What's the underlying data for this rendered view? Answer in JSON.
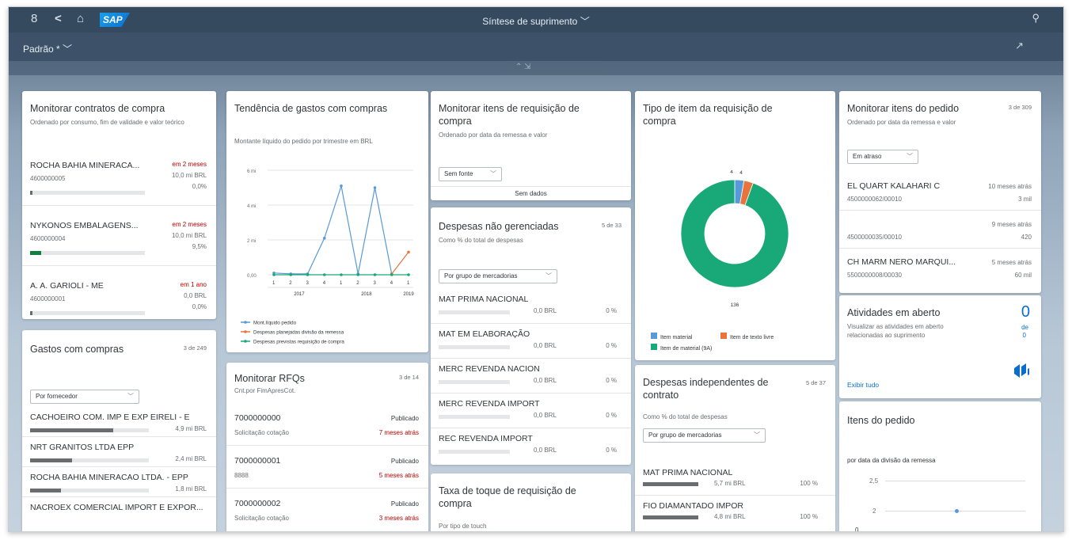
{
  "shell": {
    "title": "Síntese de suprimento",
    "title_chevron": "﹀",
    "user_icon": "8",
    "back_icon": "<",
    "home_icon": "⌂",
    "logo": "SAP",
    "search_icon": "⚲",
    "share_icon": "↗"
  },
  "variant": "Padrão * ﹀",
  "cards": {
    "contracts": {
      "title": "Monitorar contratos de compra",
      "subtitle": "Ordenado por consumo, fim de validade e valor teórico",
      "items": [
        {
          "name": "ROCHA BAHIA MINERACA...",
          "id": "4600000005",
          "time": "em 2 meses",
          "amount": "10,0 mi BRL",
          "percent": "0,0%",
          "fill": 0.02
        },
        {
          "name": "NYKONOS EMBALAGENS...",
          "id": "4600000004",
          "time": "em 2 meses",
          "amount": "10,0 mi BRL",
          "percent": "9,5%",
          "fill": 0.095
        },
        {
          "name": "A. A. GARIOLI - ME",
          "id": "4600000001",
          "time": "em 1 ano",
          "amount": "0,0 BRL",
          "percent": "0,0%",
          "fill": 0.02
        }
      ]
    },
    "gastos": {
      "title": "Gastos com compras",
      "count": "3 de 249",
      "select": "Por fornecedor",
      "items": [
        {
          "name": "CACHOEIRO COM. IMP E EXP EIRELI - E",
          "amount": "4,9 mi BRL",
          "fill": 0.7
        },
        {
          "name": "NRT GRANITOS LTDA EPP",
          "amount": "2,4 mi BRL",
          "fill": 0.35
        },
        {
          "name": "ROCHA BAHIA MINERACAO LTDA. - EPP",
          "amount": "1,8 mi BRL",
          "fill": 0.26
        },
        {
          "name": "NACROEX COMERCIAL IMPORT E EXPOR...",
          "amount": "",
          "fill": 0
        }
      ]
    },
    "trend": {
      "title": "Tendência de gastos com compras",
      "subtitle": "Montante líquido do pedido por trimestre em BRL"
    },
    "rfq": {
      "title": "Monitorar RFQs",
      "count": "3 de 14",
      "subtitle": "Cnt.por FimApresCot.",
      "items": [
        {
          "id": "7000000000",
          "status": "Publicado",
          "desc": "Solicitação cotação",
          "time": "7 meses atrás"
        },
        {
          "id": "7000000001",
          "status": "Publicado",
          "desc": "8888",
          "time": "5 meses atrás"
        },
        {
          "id": "7000000002",
          "status": "Publicado",
          "desc": "Solicitação cotação",
          "time": "3 meses atrás"
        }
      ]
    },
    "req": {
      "title": "Monitorar itens de requisição de compra",
      "subtitle": "Ordenado por data da remessa e valor",
      "select": "Sem fonte",
      "nodata": "Sem dados"
    },
    "despesas": {
      "title": "Despesas não gerenciadas",
      "count": "5 de 33",
      "subtitle": "Como % do total de despesas",
      "select": "Por grupo de mercadorias",
      "items": [
        {
          "name": "MAT PRIMA NACIONAL",
          "amount": "0,0 BRL",
          "pct": "0 %"
        },
        {
          "name": "MAT EM ELABORAÇÃO",
          "amount": "0,0 BRL",
          "pct": "0 %"
        },
        {
          "name": "MERC REVENDA NACION",
          "amount": "0,0 BRL",
          "pct": "0 %"
        },
        {
          "name": "MERC REVENDA IMPORT",
          "amount": "0,0 BRL",
          "pct": "0 %"
        },
        {
          "name": "REC REVENDA IMPORT",
          "amount": "0,0 BRL",
          "pct": "0 %"
        }
      ]
    },
    "taxa": {
      "title": "Taxa de toque de requisição de compra",
      "subtitle": "Por tipo de touch"
    },
    "tipo": {
      "title": "Tipo de item da requisição de compra",
      "label_a": "4",
      "label_b": "4",
      "label_main": "136",
      "legend": [
        {
          "label": "Item material",
          "color": "#5899da"
        },
        {
          "label": "Item de texto livre",
          "color": "#e8743b"
        },
        {
          "label": "Item de material (9A)",
          "color": "#19a979"
        }
      ]
    },
    "indep": {
      "title": "Despesas independentes de contrato",
      "count": "5 de 37",
      "subtitle": "Como % do total de despesas",
      "select": "Por grupo de mercadorias",
      "items": [
        {
          "name": "MAT PRIMA NACIONAL",
          "amount": "5,7 mi BRL",
          "pct": "100 %",
          "fill": 0.45
        },
        {
          "name": "FIO DIAMANTADO IMPOR",
          "amount": "4,8 mi BRL",
          "pct": "100 %",
          "fill": 0.38
        }
      ]
    },
    "pedido": {
      "title": "Monitorar itens do pedido",
      "count": "3 de 309",
      "subtitle": "Ordenado por data da remessa e valor",
      "select": "Em atraso",
      "items": [
        {
          "name": "EL QUART KALAHARI C",
          "time": "10 meses atrás",
          "id": "4500000062/00010",
          "val": "3 mil"
        },
        {
          "name": "",
          "time": "9 meses atrás",
          "id": "4500000035/00010",
          "val": "420"
        },
        {
          "name": "CH MARM NERO MARQUI...",
          "time": "5 meses atrás",
          "id": "5500000008/00030",
          "val": "60 mil"
        }
      ]
    },
    "atividades": {
      "title": "Atividades em aberto",
      "subtitle": "Visualizar as atividades em aberto relacionadas ao suprimento",
      "number": "0",
      "of": "de",
      "of2": "0",
      "link": "Exibir tudo"
    },
    "itens": {
      "title": "Itens do pedido",
      "subtitle": "por data da divisão da remessa",
      "y1": "2,5",
      "y2": "2",
      "y3": "0"
    }
  },
  "chart_data": {
    "type": "line",
    "x": [
      "1",
      "2",
      "3",
      "4",
      "1",
      "2",
      "3",
      "4",
      "1"
    ],
    "years": [
      {
        "label": "2017",
        "idx": [
          0,
          3
        ]
      },
      {
        "label": "2018",
        "idx": [
          4,
          7
        ]
      },
      {
        "label": "2019",
        "idx": [
          8,
          8
        ]
      }
    ],
    "yticks": [
      "0,00",
      "2 mi",
      "4 mi",
      "6 mi"
    ],
    "ylim": [
      0,
      6
    ],
    "series": [
      {
        "name": "Mont.líquido pedido",
        "color": "#5899da",
        "values": [
          0.1,
          0.05,
          0.05,
          2.1,
          5.1,
          0.05,
          5.0,
          0.05,
          null
        ]
      },
      {
        "name": "Despesas planejadas divisão da remessa",
        "color": "#e8743b",
        "values": [
          null,
          null,
          null,
          null,
          null,
          null,
          null,
          0.05,
          1.3
        ]
      },
      {
        "name": "Despesas previstas requisição de compra",
        "color": "#19a979",
        "values": [
          0,
          0,
          0,
          0,
          0,
          0,
          0,
          0,
          0
        ]
      }
    ]
  },
  "donut_data": {
    "type": "pie",
    "values": [
      4,
      4,
      136
    ]
  }
}
